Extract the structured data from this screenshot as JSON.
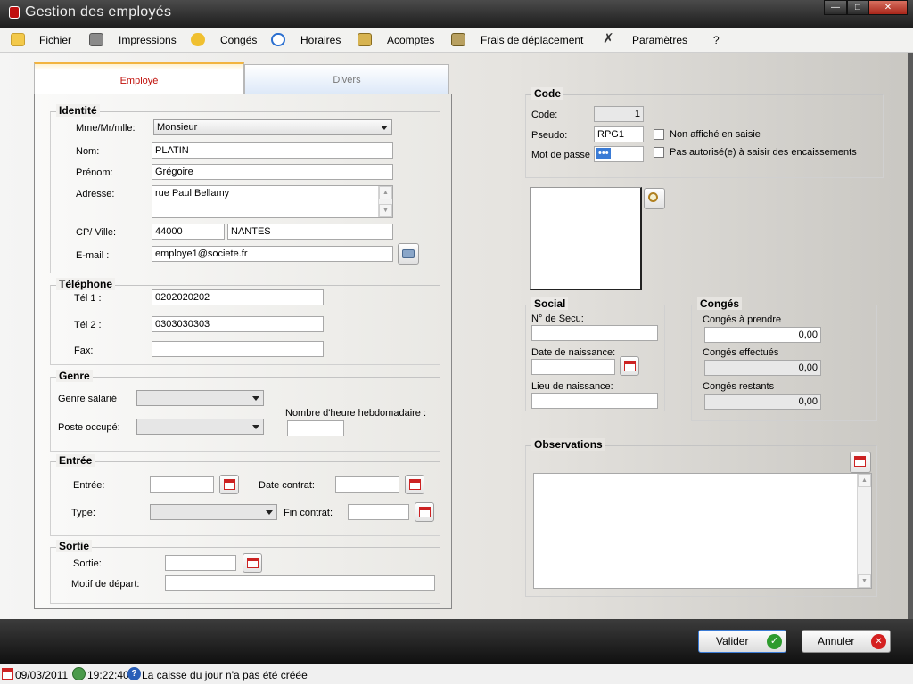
{
  "window": {
    "title": "Gestion des employés"
  },
  "menu": [
    {
      "label": "Fichier",
      "icon": "folder-icon"
    },
    {
      "label": "Impressions",
      "icon": "printer-icon"
    },
    {
      "label": "Congés",
      "icon": "sun-cloud-icon"
    },
    {
      "label": "Horaires",
      "icon": "clock-icon"
    },
    {
      "label": "Acomptes",
      "icon": "money-icon"
    },
    {
      "label": "Frais de déplacement",
      "icon": "travel-icon"
    },
    {
      "label": "Paramètres",
      "icon": "tools-icon"
    },
    {
      "label": "?"
    }
  ],
  "tabs": {
    "active": "Employé",
    "other": "Divers"
  },
  "identite": {
    "title": "Identité",
    "civ_label": "Mme/Mr/mlle:",
    "civ_value": "Monsieur",
    "nom_label": "Nom:",
    "nom_value": "PLATIN",
    "prenom_label": "Prénom:",
    "prenom_value": "Grégoire",
    "adresse_label": "Adresse:",
    "adresse_value": "rue Paul Bellamy",
    "cp_label": "CP/ Ville:",
    "cp_value": "44000",
    "ville_value": "NANTES",
    "email_label": "E-mail :",
    "email_value": "employe1@societe.fr"
  },
  "telephone": {
    "title": "Téléphone",
    "tel1_label": "Tél 1 :",
    "tel1_value": "0202020202",
    "tel2_label": "Tél 2 :",
    "tel2_value": "0303030303",
    "fax_label": "Fax:",
    "fax_value": ""
  },
  "genre": {
    "title": "Genre",
    "salarie_label": "Genre salarié",
    "poste_label": "Poste occupé:",
    "heures_label": "Nombre d'heure hebdomadaire :"
  },
  "entree": {
    "title": "Entrée",
    "entree_label": "Entrée:",
    "date_contrat_label": "Date contrat:",
    "type_label": "Type:",
    "fin_contrat_label": "Fin contrat:"
  },
  "sortie": {
    "title": "Sortie",
    "sortie_label": "Sortie:",
    "motif_label": "Motif de départ:"
  },
  "code": {
    "title": "Code",
    "code_label": "Code:",
    "code_value": "1",
    "pseudo_label": "Pseudo:",
    "pseudo_value": "RPG1",
    "mdp_label": "Mot de passe",
    "mdp_value": "•••",
    "non_affiche_label": "Non affiché en saisie",
    "pas_autorise_label": "Pas autorisé(e) à saisir des encaissements"
  },
  "social": {
    "title": "Social",
    "secu_label": "N° de Secu:",
    "naissance_label": "Date de naissance:",
    "lieu_label": "Lieu de naissance:"
  },
  "conges": {
    "title": "Congés",
    "a_prendre_label": "Congés à prendre",
    "a_prendre_value": "0,00",
    "effectues_label": "Congés effectués",
    "effectues_value": "0,00",
    "restants_label": "Congés restants",
    "restants_value": "0,00"
  },
  "observations": {
    "title": "Observations",
    "value": ""
  },
  "actions": {
    "valider": "Valider",
    "annuler": "Annuler"
  },
  "status": {
    "date": "09/03/2011",
    "time": "19:22:40",
    "message": "La caisse du jour n'a pas été créée"
  },
  "colors": {
    "accent_tab": "#c0100a",
    "valider_icon": "#2e9b2e",
    "annuler_icon": "#d42020"
  }
}
